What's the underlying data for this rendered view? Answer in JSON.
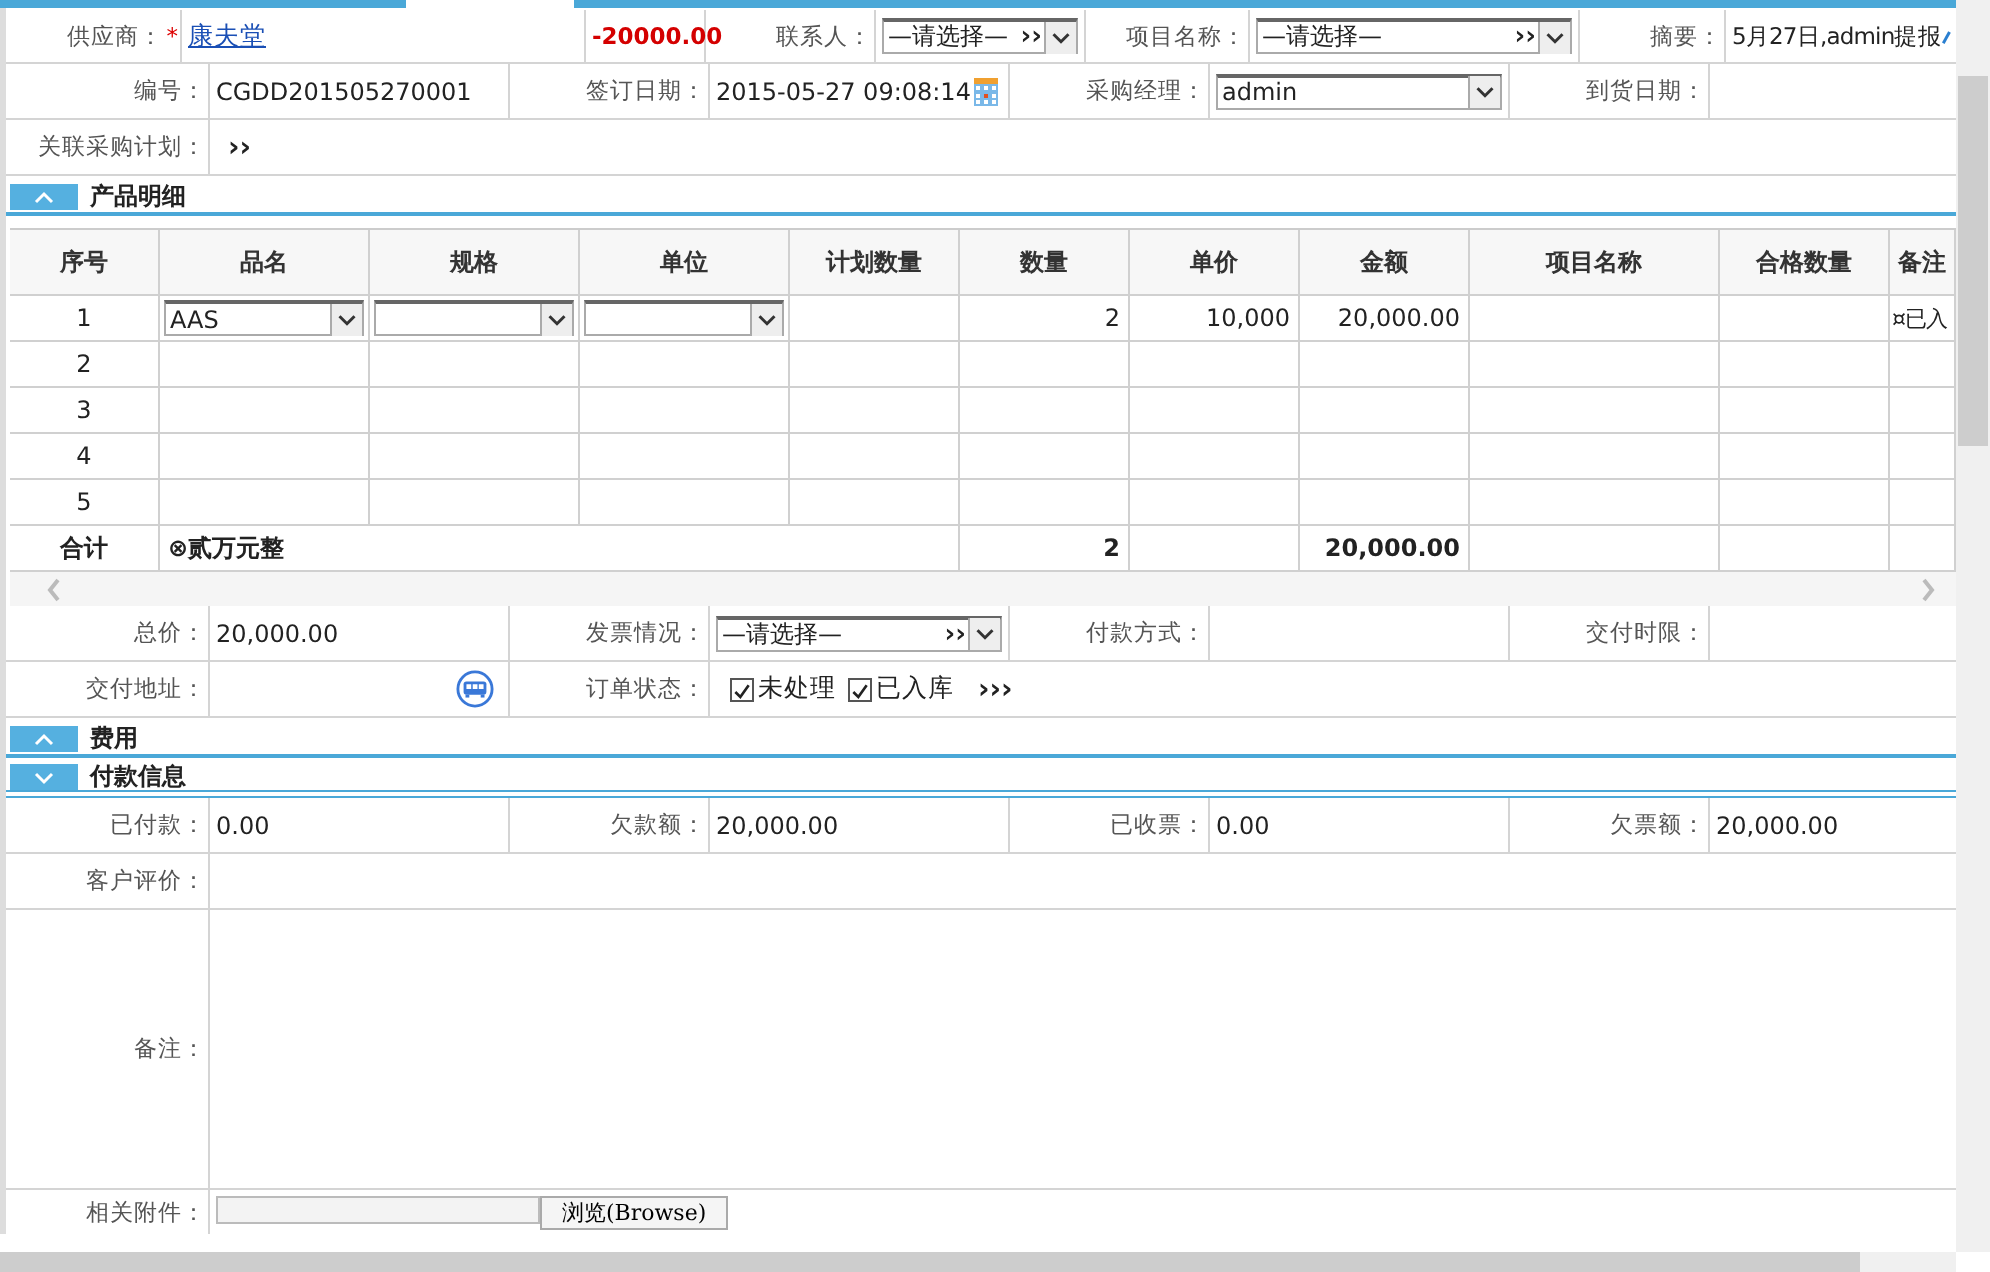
{
  "info_rows": [
    {
      "cells": [
        {
          "kind": "label",
          "text": "供应商：",
          "required_mark": "*"
        },
        {
          "kind": "link",
          "text": "康夫堂"
        },
        {
          "kind": "amount",
          "text": "-20000.00"
        },
        {
          "kind": "label",
          "text": "联系人："
        },
        {
          "kind": "select",
          "value": "—请选择—",
          "more": "››"
        },
        {
          "kind": "label",
          "text": "项目名称："
        },
        {
          "kind": "select",
          "value": "—请选择—",
          "more": "››"
        },
        {
          "kind": "label",
          "text": "摘要："
        },
        {
          "kind": "memo",
          "text": "5月27日,admin提报"
        }
      ]
    },
    {
      "cells": [
        {
          "kind": "label",
          "text": "编号："
        },
        {
          "kind": "text",
          "text": "CGDD201505270001"
        },
        {
          "kind": "label",
          "text": "签订日期："
        },
        {
          "kind": "date",
          "text": "2015-05-27 09:08:14"
        },
        {
          "kind": "label",
          "text": "采购经理："
        },
        {
          "kind": "select",
          "value": "admin"
        },
        {
          "kind": "label",
          "text": "到货日期："
        },
        {
          "kind": "blank"
        }
      ]
    },
    {
      "cells": [
        {
          "kind": "label",
          "text": "关联采购计划："
        },
        {
          "kind": "more",
          "text": "››"
        }
      ]
    }
  ],
  "product_section": {
    "title": "产品明细",
    "expanded": true,
    "table": {
      "columns": [
        "序号",
        "品名",
        "规格",
        "单位",
        "计划数量",
        "数量",
        "单价",
        "金额",
        "项目名称",
        "合格数量",
        "备注"
      ],
      "rows": [
        {
          "index": "1",
          "cells": [
            {
              "kind": "select",
              "value": "AAS"
            },
            {
              "kind": "select"
            },
            {
              "kind": "select"
            },
            {
              "kind": "blank"
            },
            {
              "kind": "number",
              "text": "2"
            },
            {
              "kind": "number",
              "text": "10,000"
            },
            {
              "kind": "number",
              "text": "20,000.00"
            },
            {
              "kind": "blank"
            },
            {
              "kind": "blank"
            },
            {
              "kind": "text",
              "text": "¤已入"
            }
          ]
        },
        {
          "index": "2"
        },
        {
          "index": "3"
        },
        {
          "index": "4"
        },
        {
          "index": "5"
        }
      ],
      "total": {
        "label": "合计",
        "amount_words": "⊗贰万元整",
        "quantity": "2",
        "amount": "20,000.00"
      }
    }
  },
  "order_rows": [
    {
      "cells": [
        {
          "kind": "label",
          "text": "总价："
        },
        {
          "kind": "text",
          "text": "20,000.00"
        },
        {
          "kind": "label",
          "text": "发票情况："
        },
        {
          "kind": "select",
          "value": "—请选择—",
          "more": "››"
        },
        {
          "kind": "label",
          "text": "付款方式："
        },
        {
          "kind": "blank"
        },
        {
          "kind": "label",
          "text": "交付时限："
        },
        {
          "kind": "blank"
        }
      ]
    },
    {
      "cells": [
        {
          "kind": "label",
          "text": "交付地址："
        },
        {
          "kind": "address"
        },
        {
          "kind": "label",
          "text": "订单状态："
        },
        {
          "kind": "checks",
          "items": [
            {
              "label": "未处理",
              "checked": true
            },
            {
              "label": "已入库",
              "checked": true
            }
          ],
          "more": "›››"
        }
      ]
    }
  ],
  "fee_section": {
    "title": "费用",
    "expanded": true
  },
  "payment_section": {
    "title": "付款信息",
    "expanded": false
  },
  "payment_rows": [
    {
      "cells": [
        {
          "kind": "label",
          "text": "已付款："
        },
        {
          "kind": "text",
          "text": "0.00"
        },
        {
          "kind": "label",
          "text": "欠款额："
        },
        {
          "kind": "text",
          "text": "20,000.00"
        },
        {
          "kind": "label",
          "text": "已收票："
        },
        {
          "kind": "text",
          "text": "0.00"
        },
        {
          "kind": "label",
          "text": "欠票额："
        },
        {
          "kind": "text",
          "text": "20,000.00"
        }
      ]
    },
    {
      "cells": [
        {
          "kind": "label",
          "text": "客户评价："
        },
        {
          "kind": "blank"
        }
      ]
    },
    {
      "cells": [
        {
          "kind": "label",
          "text": "备注："
        },
        {
          "kind": "textarea"
        }
      ]
    },
    {
      "cells": [
        {
          "kind": "label",
          "text": "相关附件："
        },
        {
          "kind": "file",
          "button": "浏览(Browse)"
        }
      ]
    }
  ]
}
